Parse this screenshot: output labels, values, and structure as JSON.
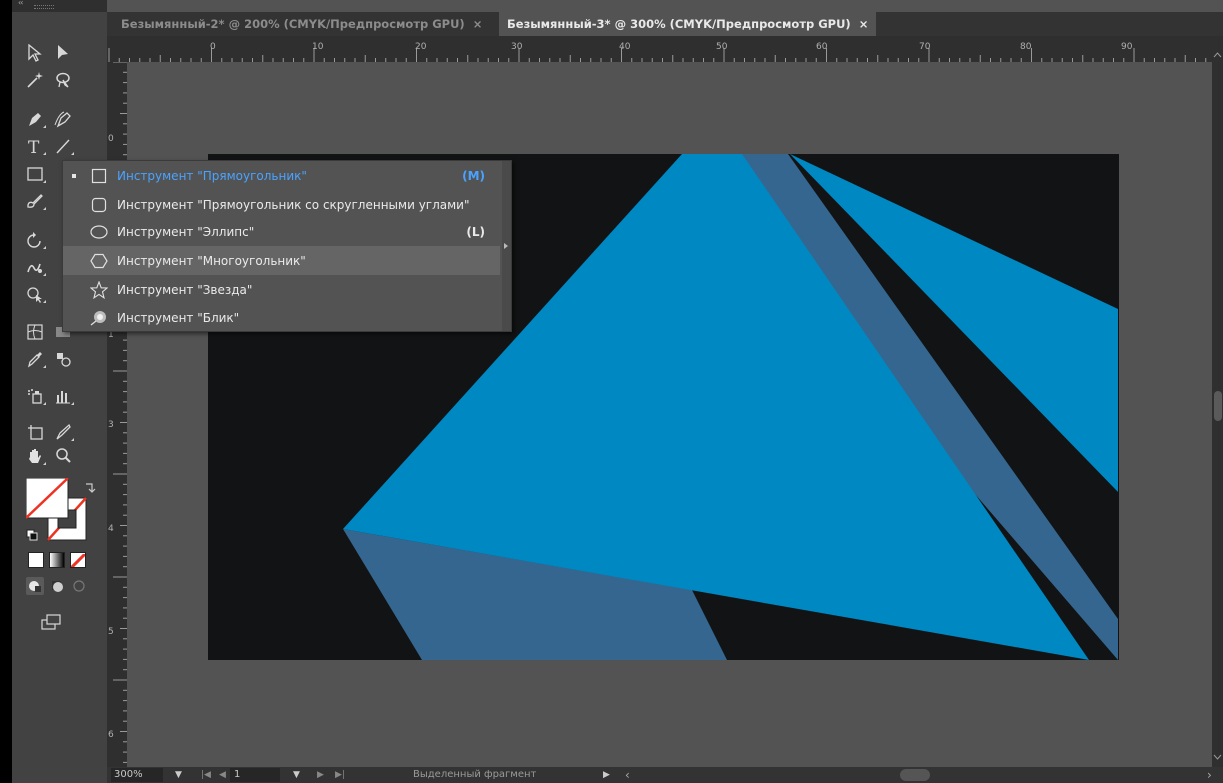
{
  "tabs": [
    {
      "title": "Безымянный-2* @ 200% (CMYK/Предпросмотр GPU)",
      "close": "×"
    },
    {
      "title": "Безымянный-3* @ 300% (CMYK/Предпросмотр GPU)",
      "close": "×"
    }
  ],
  "toolbar": {
    "collapse": "‹‹",
    "tools": [
      "selection-tool",
      "direct-selection-tool",
      "magic-wand-tool",
      "lasso-tool",
      "pen-tool",
      "curvature-tool",
      "type-tool",
      "line-segment-tool",
      "rectangle-tool",
      "paintbrush-tool",
      "rotate-tool",
      "warp-tool",
      "shape-builder-tool",
      "mesh-tool",
      "eyedropper-tool",
      "blend-tool",
      "symbol-sprayer-tool",
      "column-graph-tool",
      "artboard-tool",
      "slice-tool",
      "hand-tool",
      "zoom-tool",
      "fill-stroke-swatch",
      "color-modes",
      "draw-modes",
      "screen-mode"
    ]
  },
  "ruler": {
    "h_labels": [
      "0",
      "10",
      "20",
      "30",
      "40",
      "50",
      "60",
      "70",
      "80",
      "90"
    ],
    "v_labels": [
      "0",
      "1",
      "2",
      "3",
      "4",
      "5",
      "6"
    ]
  },
  "flyout": {
    "items": [
      {
        "label": "Инструмент \"Прямоугольник\"",
        "key": "(M)",
        "icon": "rectangle-icon",
        "active": true
      },
      {
        "label": "Инструмент \"Прямоугольник со скругленными углами\"",
        "key": "",
        "icon": "rounded-rectangle-icon"
      },
      {
        "label": "Инструмент \"Эллипс\"",
        "key": "(L)",
        "icon": "ellipse-icon"
      },
      {
        "label": "Инструмент \"Многоугольник\"",
        "key": "",
        "icon": "polygon-icon",
        "hover": true
      },
      {
        "label": "Инструмент \"Звезда\"",
        "key": "",
        "icon": "star-icon"
      },
      {
        "label": "Инструмент \"Блик\"",
        "key": "",
        "icon": "flare-icon"
      }
    ]
  },
  "status": {
    "zoom": "300%",
    "page": "1",
    "text": "Выделенный фрагмент"
  },
  "colors": {
    "artboard_bg": "#111314",
    "shape_bright": "#0088c2",
    "shape_muted": "#35668f",
    "accent": "#4aa3ff"
  }
}
